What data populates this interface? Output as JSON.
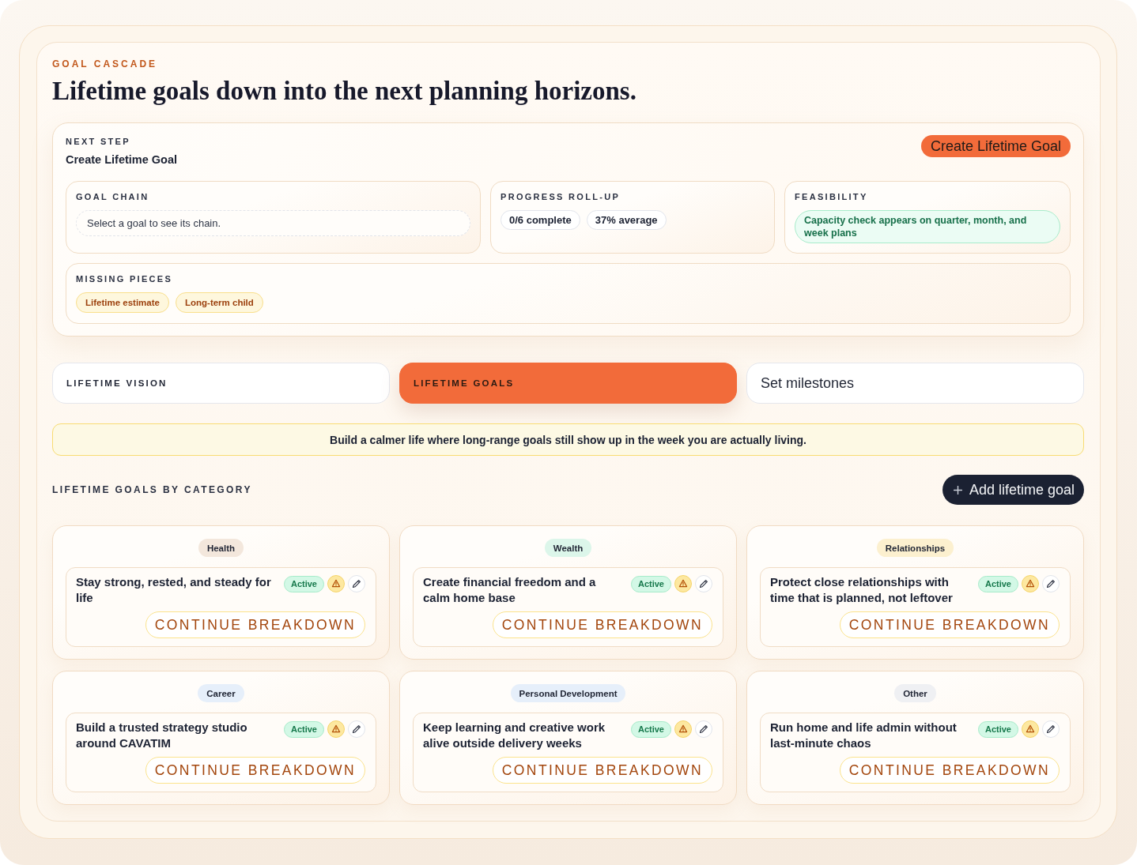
{
  "header": {
    "eyebrow": "GOAL CASCADE",
    "title": "Lifetime goals down into the next planning horizons."
  },
  "next_step": {
    "label": "NEXT STEP",
    "value": "Create Lifetime Goal",
    "button": "Create Lifetime Goal",
    "goal_chain": {
      "label": "GOAL CHAIN",
      "empty_message": "Select a goal to see its chain."
    },
    "progress": {
      "label": "PROGRESS ROLL-UP",
      "chips": [
        "0/6 complete",
        "37% average"
      ]
    },
    "feasibility": {
      "label": "FEASIBILITY",
      "note": "Capacity check appears on quarter, month, and week plans"
    },
    "missing_pieces": {
      "label": "MISSING PIECES",
      "tags": [
        "Lifetime estimate",
        "Long-term child"
      ]
    }
  },
  "tabs": [
    {
      "label": "LIFETIME VISION",
      "kind": "stage",
      "selected": false
    },
    {
      "label": "LIFETIME GOALS",
      "kind": "stage",
      "selected": true
    },
    {
      "label": "Set milestones",
      "kind": "action",
      "selected": false
    }
  ],
  "banner": "Build a calmer life where long-range goals still show up in the week you are actually living.",
  "goals_section": {
    "heading": "LIFETIME GOALS BY CATEGORY",
    "add_button": "Add lifetime goal"
  },
  "categories": [
    {
      "name": "Health",
      "color": "#f3e7dc",
      "goal": {
        "title": "Stay strong, rested, and steady for life",
        "status": "Active",
        "warning": true,
        "action": "CONTINUE BREAKDOWN"
      }
    },
    {
      "name": "Wealth",
      "color": "#dcf6ea",
      "goal": {
        "title": "Create financial freedom and a calm home base",
        "status": "Active",
        "warning": true,
        "action": "CONTINUE BREAKDOWN"
      }
    },
    {
      "name": "Relationships",
      "color": "#fcf0cf",
      "goal": {
        "title": "Protect close relationships with time that is planned, not leftover",
        "status": "Active",
        "warning": true,
        "action": "CONTINUE BREAKDOWN"
      }
    },
    {
      "name": "Career",
      "color": "#e6effa",
      "goal": {
        "title": "Build a trusted strategy studio around CAVATIM",
        "status": "Active",
        "warning": true,
        "action": "CONTINUE BREAKDOWN"
      }
    },
    {
      "name": "Personal Development",
      "color": "#e6effa",
      "goal": {
        "title": "Keep learning and creative work alive outside delivery weeks",
        "status": "Active",
        "warning": true,
        "action": "CONTINUE BREAKDOWN"
      }
    },
    {
      "name": "Other",
      "color": "#eff0f3",
      "goal": {
        "title": "Run home and life admin without last-minute chaos",
        "status": "Active",
        "warning": true,
        "action": "CONTINUE BREAKDOWN"
      }
    }
  ]
}
